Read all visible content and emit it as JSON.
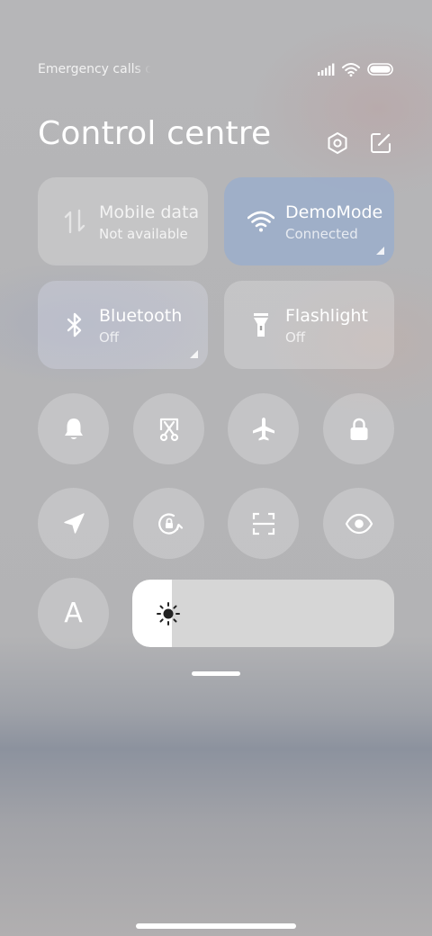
{
  "status_bar": {
    "text": "Emergency calls only",
    "icons": [
      "signal-icon",
      "wifi-icon",
      "battery-icon"
    ]
  },
  "header": {
    "title": "Control centre",
    "actions": [
      "settings-icon",
      "edit-icon"
    ]
  },
  "tiles": [
    {
      "name": "Mobile data",
      "status": "Not available",
      "icon": "mobile-data-icon",
      "active": false,
      "has_expand": false
    },
    {
      "name": "DemoMode",
      "status": "Connected",
      "icon": "wifi-icon",
      "active": true,
      "has_expand": true
    },
    {
      "name": "Bluetooth",
      "status": "Off",
      "icon": "bluetooth-icon",
      "active": false,
      "has_expand": true
    },
    {
      "name": "Flashlight",
      "status": "Off",
      "icon": "flashlight-icon",
      "active": false,
      "has_expand": false
    }
  ],
  "toggles": [
    {
      "icon": "bell-icon",
      "label": "Sound"
    },
    {
      "icon": "screenshot-icon",
      "label": "Screenshot"
    },
    {
      "icon": "airplane-icon",
      "label": "Airplane mode"
    },
    {
      "icon": "lock-icon",
      "label": "Lock screen"
    },
    {
      "icon": "location-icon",
      "label": "Location"
    },
    {
      "icon": "rotation-lock-icon",
      "label": "Rotation lock"
    },
    {
      "icon": "scanner-icon",
      "label": "Scanner"
    },
    {
      "icon": "eye-icon",
      "label": "Reading mode"
    },
    {
      "icon": "auto-brightness-icon",
      "label": "A"
    }
  ],
  "brightness": {
    "level_percent": 15,
    "icon": "sun-icon"
  },
  "colors": {
    "accent_tile": "#8CAAD7",
    "tile": "#FFFFFF38",
    "slider_track": "#D6D6D6",
    "slider_fill": "#FFFFFF"
  }
}
